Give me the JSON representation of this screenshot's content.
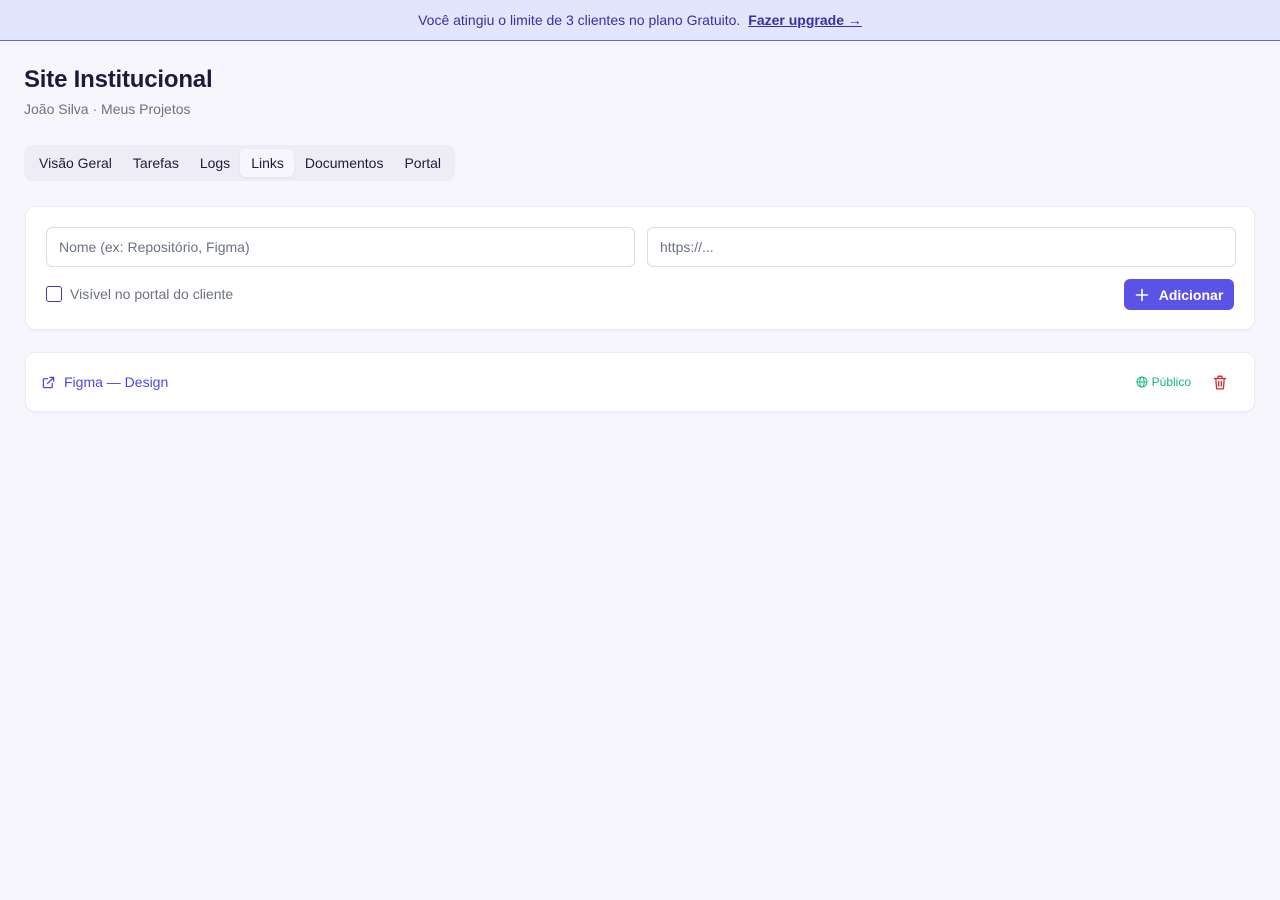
{
  "banner": {
    "message": "Você atingiu o limite de 3 clientes no plano Gratuito.",
    "upgrade_label": "Fazer upgrade →"
  },
  "header": {
    "title": "Site Institucional",
    "subtitle": "João Silva · Meus Projetos"
  },
  "tabs": [
    {
      "label": "Visão Geral",
      "active": false
    },
    {
      "label": "Tarefas",
      "active": false
    },
    {
      "label": "Logs",
      "active": false
    },
    {
      "label": "Links",
      "active": true
    },
    {
      "label": "Documentos",
      "active": false
    },
    {
      "label": "Portal",
      "active": false
    }
  ],
  "form": {
    "name_placeholder": "Nome (ex: Repositório, Figma)",
    "url_placeholder": "https://...",
    "visible_label": "Visível no portal do cliente",
    "visible_checked": false,
    "add_label": "Adicionar",
    "add_icon": "plus-icon"
  },
  "links": [
    {
      "label": "Figma — Design",
      "icon": "external-link-icon",
      "visibility": "Público",
      "visibility_icon": "globe-icon",
      "delete_icon": "trash-icon"
    }
  ],
  "colors": {
    "accent": "#5b53e6",
    "link": "#4f46e5",
    "public": "#10b981",
    "danger": "#dc2626",
    "banner_bg": "#e2e6fd",
    "page_bg": "#f7f6fd"
  }
}
